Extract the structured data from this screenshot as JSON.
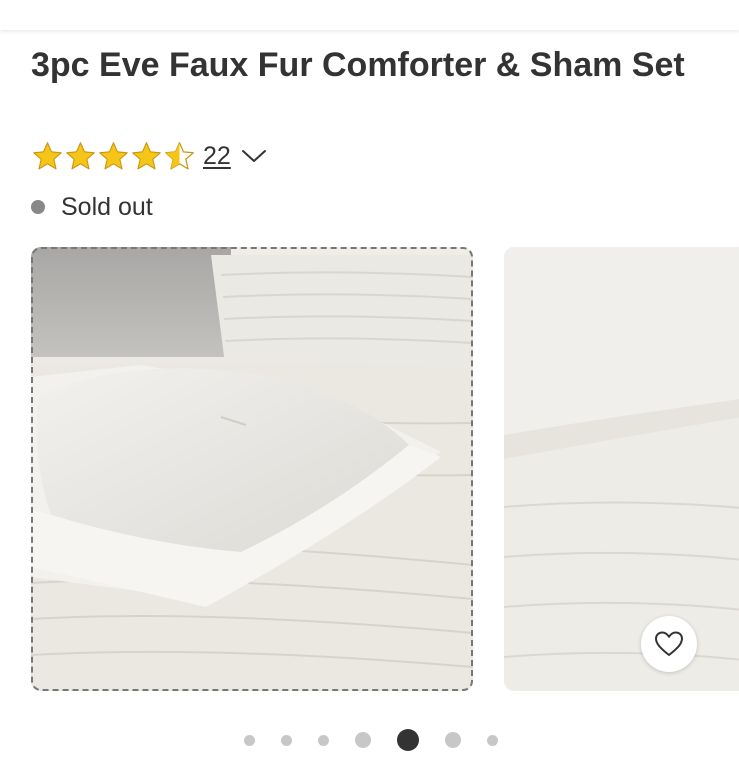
{
  "product": {
    "title": "3pc Eve Faux Fur Comforter & Sham Set",
    "rating": {
      "value": 4.5,
      "max": 5,
      "review_count": "22",
      "star_color": "#F5C518",
      "expand_icon": "chevron-down-icon"
    },
    "availability": {
      "status": "Sold out",
      "dot_color": "#888888"
    }
  },
  "gallery": {
    "images": [
      {
        "name": "product-image-pillow-sham",
        "selected": true
      },
      {
        "name": "product-image-comforter-detail",
        "selected": false
      }
    ],
    "favorite_icon": "heart-outline-icon",
    "pagination": {
      "total": 7,
      "active_index": 4
    }
  },
  "colors": {
    "text": "#333333",
    "dot_inactive": "#C7C7C7",
    "dot_active": "#333333"
  }
}
